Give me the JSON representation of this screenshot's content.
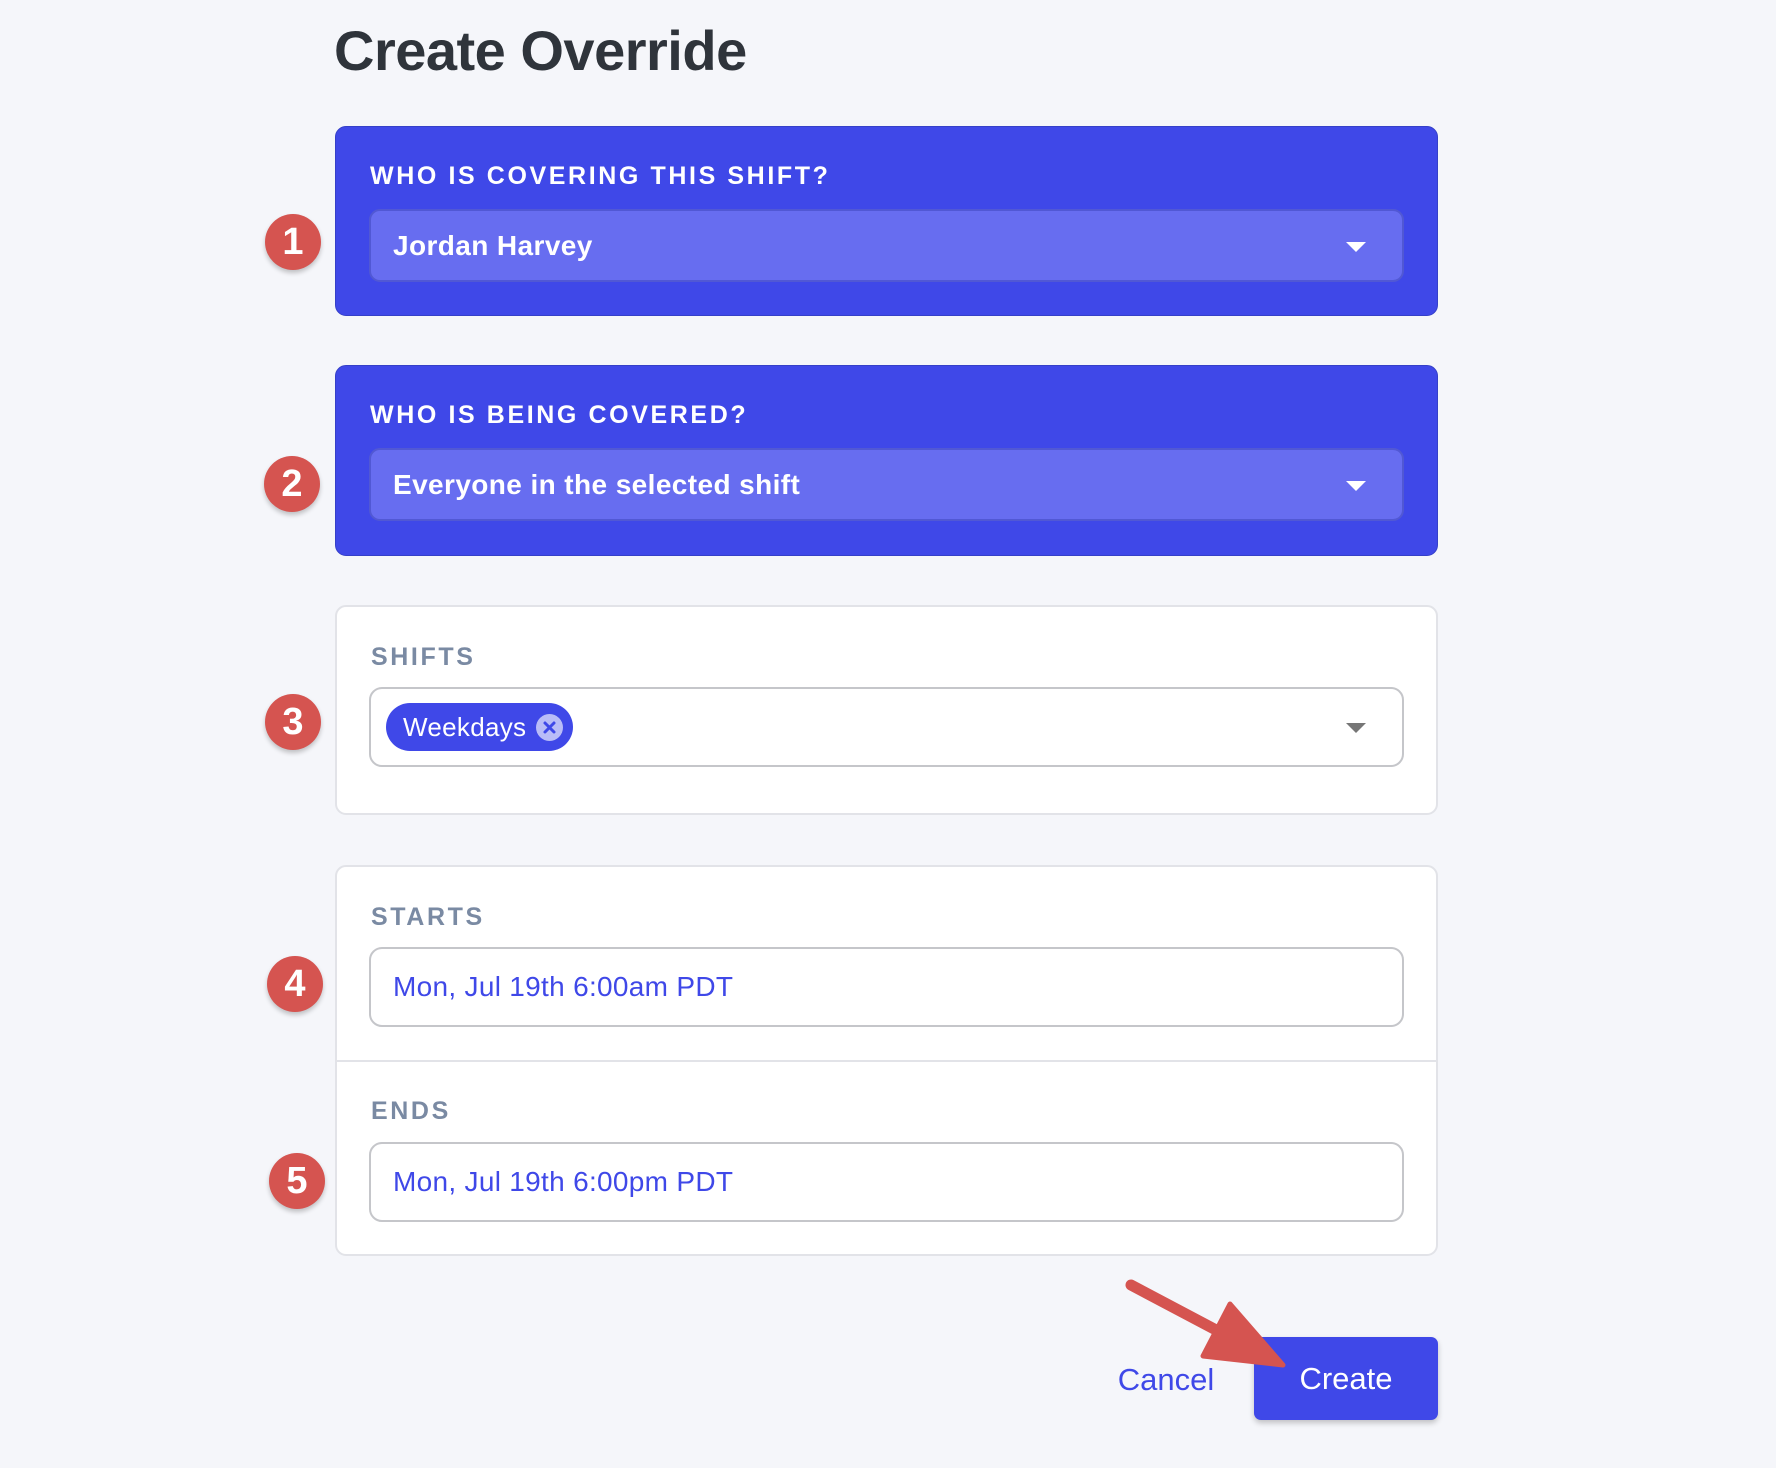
{
  "page": {
    "title": "Create Override"
  },
  "covering": {
    "label": "Who is covering this shift?",
    "value": "Jordan Harvey",
    "icon": "caret-down-icon"
  },
  "covered": {
    "label": "Who is being covered?",
    "value": "Everyone in the selected shift",
    "icon": "caret-down-icon"
  },
  "shifts": {
    "label": "Shifts",
    "selected": [
      {
        "label": "Weekdays",
        "remove_icon": "close-circle-icon"
      }
    ],
    "icon": "caret-down-icon"
  },
  "starts": {
    "label": "Starts",
    "value": "Mon, Jul 19th 6:00am PDT"
  },
  "ends": {
    "label": "Ends",
    "value": "Mon, Jul 19th 6:00pm PDT"
  },
  "actions": {
    "cancel_label": "Cancel",
    "create_label": "Create"
  },
  "annotations": {
    "badges": [
      "1",
      "2",
      "3",
      "4",
      "5"
    ],
    "arrow_target": "create-button",
    "badge_color": "#d55450",
    "arrow_color": "#d55450"
  },
  "colors": {
    "accent": "#3f48e8",
    "select_fill": "#676df0",
    "label_gray": "#7a8aa3",
    "background": "#f5f6fa"
  }
}
